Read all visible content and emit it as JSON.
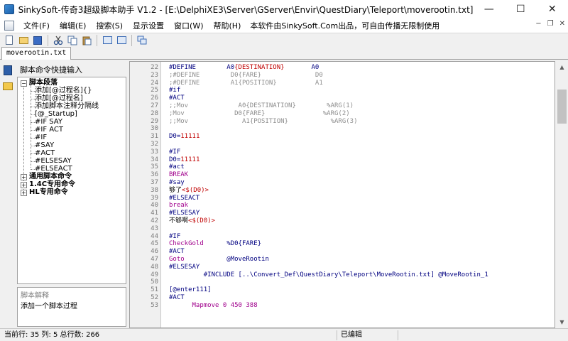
{
  "window": {
    "title": "SinkySoft-传奇3超级脚本助手 V1.2 - [E:\\DelphiXE3\\Server\\GServer\\Envir\\QuestDiary\\Teleport\\moverootin.txt]",
    "minimize_glyph": "—",
    "maximize_glyph": "☐",
    "close_glyph": "✕"
  },
  "menubar": {
    "items": [
      "文件(F)",
      "编辑(E)",
      "搜索(S)",
      "显示设置",
      "窗口(W)",
      "帮助(H)"
    ],
    "note": "本软件由SinkySoft.Com出品，可自由传播无限制使用",
    "mdi": [
      "−",
      "❐",
      "✕"
    ]
  },
  "toolbar": {
    "icons": [
      "new-file-icon",
      "open-file-icon",
      "save-icon",
      "cut-icon",
      "copy-icon",
      "paste-icon",
      "select-icon",
      "window-icon",
      "cascade-icon"
    ]
  },
  "file_tab": {
    "label": "moverootin.txt"
  },
  "left_panel": {
    "header": "脚本命令快捷输入",
    "tree": {
      "group1": "脚本段落",
      "items": [
        "添加[@过程名]{}",
        "添加[@过程名]",
        "添加脚本注释分隔线",
        "[@_Startup]",
        "#IF SAY",
        "#IF ACT",
        "#IF",
        "#SAY",
        "#ACT",
        "#ELSESAY",
        "#ELSEACT"
      ],
      "group2": "通用脚本命令",
      "group3": "1.4C专用命令",
      "group4": "HL专用命令"
    },
    "description": {
      "title": "脚本解释",
      "text": "添加一个脚本过程"
    }
  },
  "editor": {
    "lines": [
      {
        "n": "22",
        "segs": [
          [
            "kw",
            "#DEFINE        A0"
          ],
          [
            "red",
            "{DESTINATION}"
          ],
          [
            "kw",
            "       A0"
          ]
        ]
      },
      {
        "n": "23",
        "segs": [
          [
            "cmt",
            ";#DEFINE        D0{FARE}              D0"
          ]
        ]
      },
      {
        "n": "24",
        "segs": [
          [
            "cmt",
            ";#DEFINE        A1{POSITION}          A1"
          ]
        ]
      },
      {
        "n": "25",
        "segs": [
          [
            "kw",
            "#if"
          ]
        ]
      },
      {
        "n": "26",
        "segs": [
          [
            "kw",
            "#ACT"
          ]
        ]
      },
      {
        "n": "27",
        "segs": [
          [
            "cmt",
            ";;Mov             A0{DESTINATION}        %ARG(1)"
          ]
        ]
      },
      {
        "n": "28",
        "segs": [
          [
            "cmt",
            ";Mov             D0{FARE}               %ARG(2)"
          ]
        ]
      },
      {
        "n": "29",
        "segs": [
          [
            "cmt",
            ";;Mov              A1{POSITION}           %ARG(3)"
          ]
        ]
      },
      {
        "n": "30",
        "segs": []
      },
      {
        "n": "31",
        "segs": [
          [
            "kw",
            "D0="
          ],
          [
            "red",
            "11111"
          ]
        ]
      },
      {
        "n": "32",
        "segs": []
      },
      {
        "n": "33",
        "segs": [
          [
            "kw",
            "#IF"
          ]
        ]
      },
      {
        "n": "34",
        "segs": [
          [
            "kw",
            "D0="
          ],
          [
            "red",
            "11111"
          ]
        ]
      },
      {
        "n": "35",
        "segs": [
          [
            "kw",
            "#act"
          ]
        ]
      },
      {
        "n": "36",
        "segs": [
          [
            "pur",
            "BREAK"
          ]
        ]
      },
      {
        "n": "37",
        "segs": [
          [
            "kw",
            "#say"
          ]
        ]
      },
      {
        "n": "38",
        "segs": [
          [
            "blk",
            "够了"
          ],
          [
            "red",
            "<$(D0)>"
          ]
        ]
      },
      {
        "n": "39",
        "segs": [
          [
            "kw",
            "#ELSEACT"
          ]
        ]
      },
      {
        "n": "40",
        "segs": [
          [
            "pur",
            "break"
          ]
        ]
      },
      {
        "n": "41",
        "segs": [
          [
            "kw",
            "#ELSESAY"
          ]
        ]
      },
      {
        "n": "42",
        "segs": [
          [
            "blk",
            "不够啊"
          ],
          [
            "red",
            "<$(D0)>"
          ]
        ]
      },
      {
        "n": "43",
        "segs": []
      },
      {
        "n": "44",
        "segs": [
          [
            "kw",
            "#IF"
          ]
        ]
      },
      {
        "n": "45",
        "segs": [
          [
            "pur",
            "CheckGold      "
          ],
          [
            "kw",
            "%D0{FARE}"
          ]
        ]
      },
      {
        "n": "46",
        "segs": [
          [
            "kw",
            "#ACT"
          ]
        ]
      },
      {
        "n": "47",
        "segs": [
          [
            "pur",
            "Goto           "
          ],
          [
            "kw",
            "@MoveRootin"
          ]
        ]
      },
      {
        "n": "48",
        "segs": [
          [
            "kw",
            "#ELSESAY"
          ]
        ]
      },
      {
        "n": "49",
        "segs": [
          [
            "kw",
            "         #INCLUDE [..\\Convert_Def\\QuestDiary\\Teleport\\MoveRootin.txt] @MoveRootin_1"
          ]
        ]
      },
      {
        "n": "50",
        "segs": []
      },
      {
        "n": "51",
        "segs": [
          [
            "kw",
            "[@enter111]"
          ]
        ]
      },
      {
        "n": "52",
        "segs": [
          [
            "kw",
            "#ACT"
          ]
        ]
      },
      {
        "n": "53",
        "segs": [
          [
            "pur",
            "      Mapmove 0 450 388"
          ]
        ]
      }
    ]
  },
  "scrollbar": {
    "up": "▲",
    "down": "▼"
  },
  "statusbar": {
    "position": "当前行: 35  列: 5  总行数: 266",
    "state": "已编辑"
  }
}
